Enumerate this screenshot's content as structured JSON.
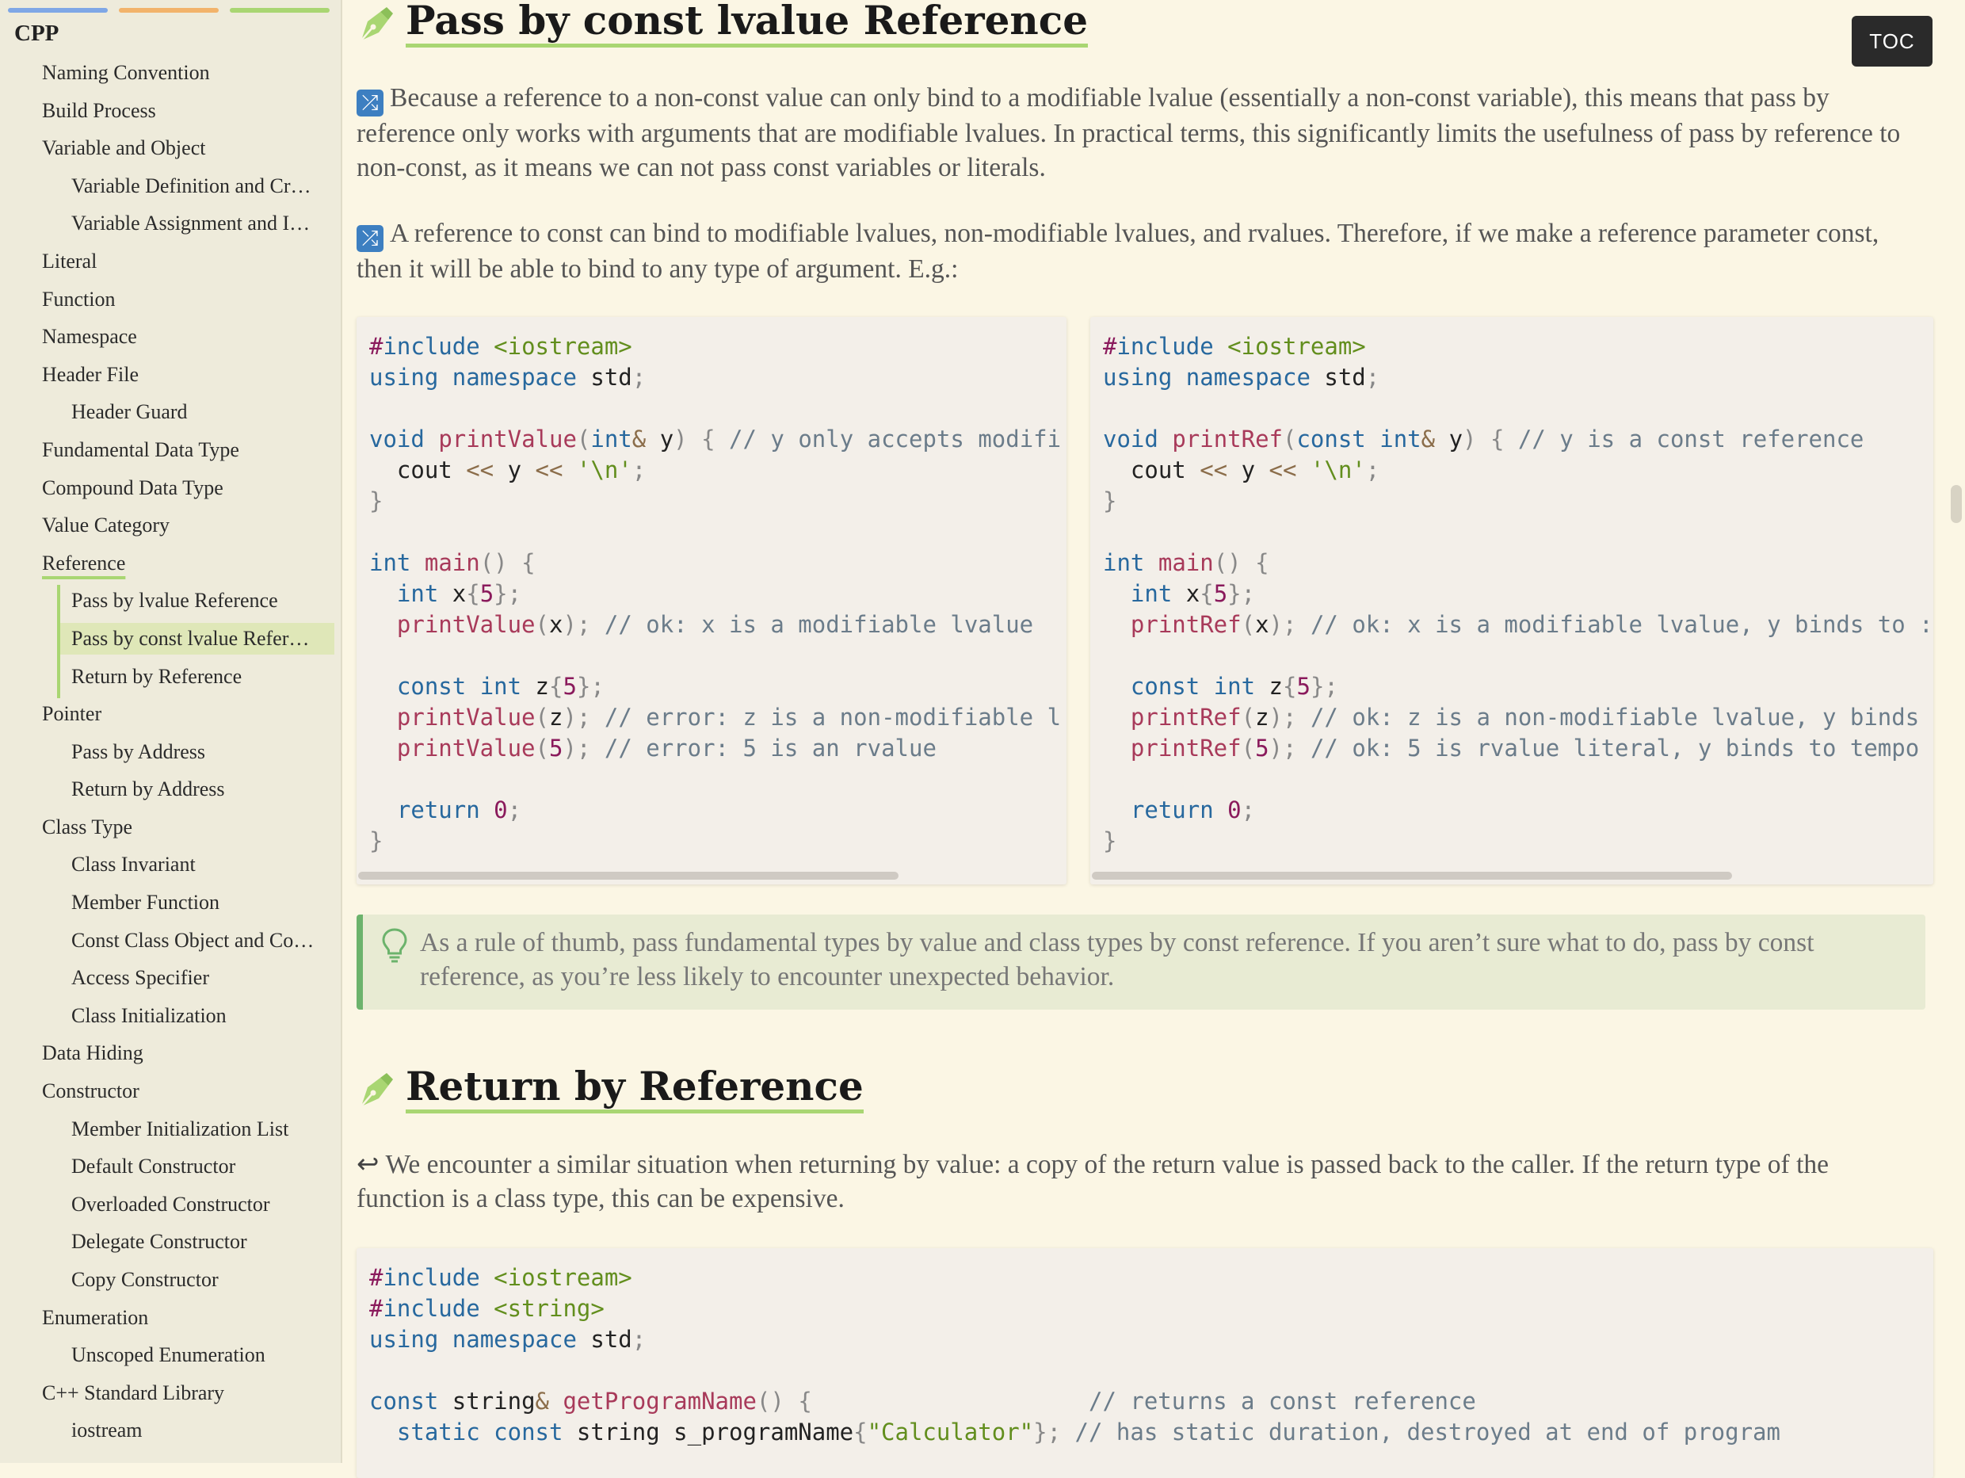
{
  "sidebar": {
    "title": "CPP",
    "items": [
      {
        "label": "Naming Convention",
        "level": 0
      },
      {
        "label": "Build Process",
        "level": 0
      },
      {
        "label": "Variable and Object",
        "level": 0
      },
      {
        "label": "Variable Definition and Cr…",
        "level": 1
      },
      {
        "label": "Variable Assignment and I…",
        "level": 1
      },
      {
        "label": "Literal",
        "level": 0
      },
      {
        "label": "Function",
        "level": 0
      },
      {
        "label": "Namespace",
        "level": 0
      },
      {
        "label": "Header File",
        "level": 0
      },
      {
        "label": "Header Guard",
        "level": 1
      },
      {
        "label": "Fundamental Data Type",
        "level": 0
      },
      {
        "label": "Compound Data Type",
        "level": 0
      },
      {
        "label": "Value Category",
        "level": 0
      },
      {
        "label": "Reference",
        "level": 0
      },
      {
        "label": "Pass by lvalue Reference",
        "level": 1
      },
      {
        "label": "Pass by const lvalue Refer…",
        "level": 1
      },
      {
        "label": "Return by Reference",
        "level": 1
      },
      {
        "label": "Pointer",
        "level": 0
      },
      {
        "label": "Pass by Address",
        "level": 1
      },
      {
        "label": "Return by Address",
        "level": 1
      },
      {
        "label": "Class Type",
        "level": 0
      },
      {
        "label": "Class Invariant",
        "level": 1
      },
      {
        "label": "Member Function",
        "level": 1
      },
      {
        "label": "Const Class Object and Co…",
        "level": 1
      },
      {
        "label": "Access Specifier",
        "level": 1
      },
      {
        "label": "Class Initialization",
        "level": 1
      },
      {
        "label": "Data Hiding",
        "level": 0
      },
      {
        "label": "Constructor",
        "level": 0
      },
      {
        "label": "Member Initialization List",
        "level": 1
      },
      {
        "label": "Default Constructor",
        "level": 1
      },
      {
        "label": "Overloaded Constructor",
        "level": 1
      },
      {
        "label": "Delegate Constructor",
        "level": 1
      },
      {
        "label": "Copy Constructor",
        "level": 1
      },
      {
        "label": "Enumeration",
        "level": 0
      },
      {
        "label": "Unscoped Enumeration",
        "level": 1
      },
      {
        "label": "C++ Standard Library",
        "level": 0
      },
      {
        "label": "iostream",
        "level": 1
      }
    ],
    "active_item": "Pass by const lvalue Refer…",
    "colors": {
      "bar_blue": "#7fa7e6",
      "bar_orange": "#f2b36b",
      "bar_green": "#a9d672",
      "active_bg": "#dfe7b8"
    }
  },
  "toc_button": "TOC",
  "section1": {
    "title": "Pass by const lvalue Reference",
    "icon": "pen-nib-icon",
    "para1_icon": "shuffle-icon",
    "para1": "Because a reference to a non-const value can only bind to a modifiable lvalue (essentially a non-const variable), this means that pass by reference only works with arguments that are modifiable lvalues. In practical terms, this significantly limits the usefulness of pass by reference to non-const, as it means we can not pass const variables or literals.",
    "para2_icon": "shuffle-icon",
    "para2": "A reference to const can bind to modifiable lvalues, non-modifiable lvalues, and rvalues. Therefore, if we make a reference parameter const, then it will be able to bind to any type of argument. E.g.:",
    "code_left": [
      "#include <iostream>",
      "using namespace std;",
      "",
      "void printValue(int& y) { // y only accepts modifi",
      "  cout << y << '\\n';",
      "}",
      "",
      "int main() {",
      "  int x{5};",
      "  printValue(x); // ok: x is a modifiable lvalue",
      "",
      "  const int z{5};",
      "  printValue(z); // error: z is a non-modifiable l",
      "  printValue(5); // error: 5 is an rvalue",
      "",
      "  return 0;",
      "}"
    ],
    "code_right": [
      "#include <iostream>",
      "using namespace std;",
      "",
      "void printRef(const int& y) { // y is a const reference",
      "  cout << y << '\\n';",
      "}",
      "",
      "int main() {",
      "  int x{5};",
      "  printRef(x); // ok: x is a modifiable lvalue, y binds to :",
      "",
      "  const int z{5};",
      "  printRef(z); // ok: z is a non-modifiable lvalue, y binds",
      "  printRef(5); // ok: 5 is rvalue literal, y binds to tempo",
      "",
      "  return 0;",
      "}"
    ],
    "tip_icon": "lightbulb-icon",
    "tip": "As a rule of thumb, pass fundamental types by value and class types by const reference. If you aren’t sure what to do, pass by const reference, as you’re less likely to encounter unexpected behavior."
  },
  "section2": {
    "title": "Return by Reference",
    "icon": "pen-nib-icon",
    "para1_icon": "return-arrow-icon",
    "para1": "We encounter a similar situation when returning by value: a copy of the return value is passed back to the caller. If the return type of the function is a class type, this can be expensive.",
    "code": [
      "#include <iostream>",
      "#include <string>",
      "using namespace std;",
      "",
      "const string& getProgramName() {                    // returns a const reference",
      "  static const string s_programName{\"Calculator\"}; // has static duration, destroyed at end of program"
    ]
  }
}
